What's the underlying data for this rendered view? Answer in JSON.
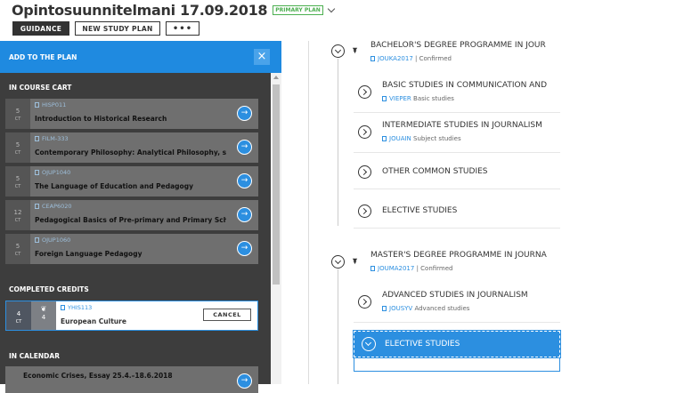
{
  "header": {
    "title": "Opintosuunnitelmani 17.09.2018",
    "badge": "PRIMARY PLAN",
    "buttons": {
      "guidance": "GUIDANCE",
      "new_plan": "NEW STUDY PLAN",
      "more": "•••"
    }
  },
  "sidebar": {
    "title": "ADD TO THE PLAN",
    "close": "×",
    "cart_label": "IN COURSE CART",
    "cart": [
      {
        "credits": "5",
        "unit": "CT",
        "code": "HISP011",
        "name": "Introduction to Historical Research"
      },
      {
        "credits": "5",
        "unit": "CT",
        "code": "FILM-333",
        "name": "Contemporary Philosophy: Analytical Philosophy, s"
      },
      {
        "credits": "5",
        "unit": "CT",
        "code": "OJUP1040",
        "name": "The Language of Education and Pedagogy"
      },
      {
        "credits": "12",
        "unit": "CT",
        "code": "CEAP6020",
        "name": "Pedagogical Basics of Pre-primary and Primary Sch"
      },
      {
        "credits": "5",
        "unit": "CT",
        "code": "OJUP1060",
        "name": "Foreign Language Pedagogy"
      }
    ],
    "completed_label": "COMPLETED CREDITS",
    "completed": {
      "credits": "4",
      "unit": "CT",
      "grade": "4",
      "code": "YHIS113",
      "name": "European Culture",
      "cancel": "CANCEL"
    },
    "calendar_label": "IN CALENDAR",
    "calendar": {
      "name": "Economic Crises, Essay 25.4.–18.6.2018"
    }
  },
  "plan": {
    "bachelor": {
      "title": "BACHELOR'S DEGREE PROGRAMME IN JOUR",
      "code": "JOUKA2017",
      "status": "| Confirmed"
    },
    "b_children": [
      {
        "title": "BASIC STUDIES IN COMMUNICATION AND",
        "code": "VIEPER",
        "sub": "Basic studies"
      },
      {
        "title": "INTERMEDIATE STUDIES IN JOURNALISM",
        "code": "JOUAIN",
        "sub": "Subject studies"
      },
      {
        "title": "OTHER COMMON STUDIES"
      },
      {
        "title": "ELECTIVE STUDIES"
      }
    ],
    "master": {
      "title": "MASTER'S DEGREE PROGRAMME IN JOURNA",
      "code": "JOUMA2017",
      "status": "| Confirmed"
    },
    "m_children": [
      {
        "title": "ADVANCED STUDIES IN JOURNALISM",
        "code": "JOUSYV",
        "sub": "Advanced studies"
      },
      {
        "title": "ELECTIVE STUDIES"
      }
    ]
  }
}
